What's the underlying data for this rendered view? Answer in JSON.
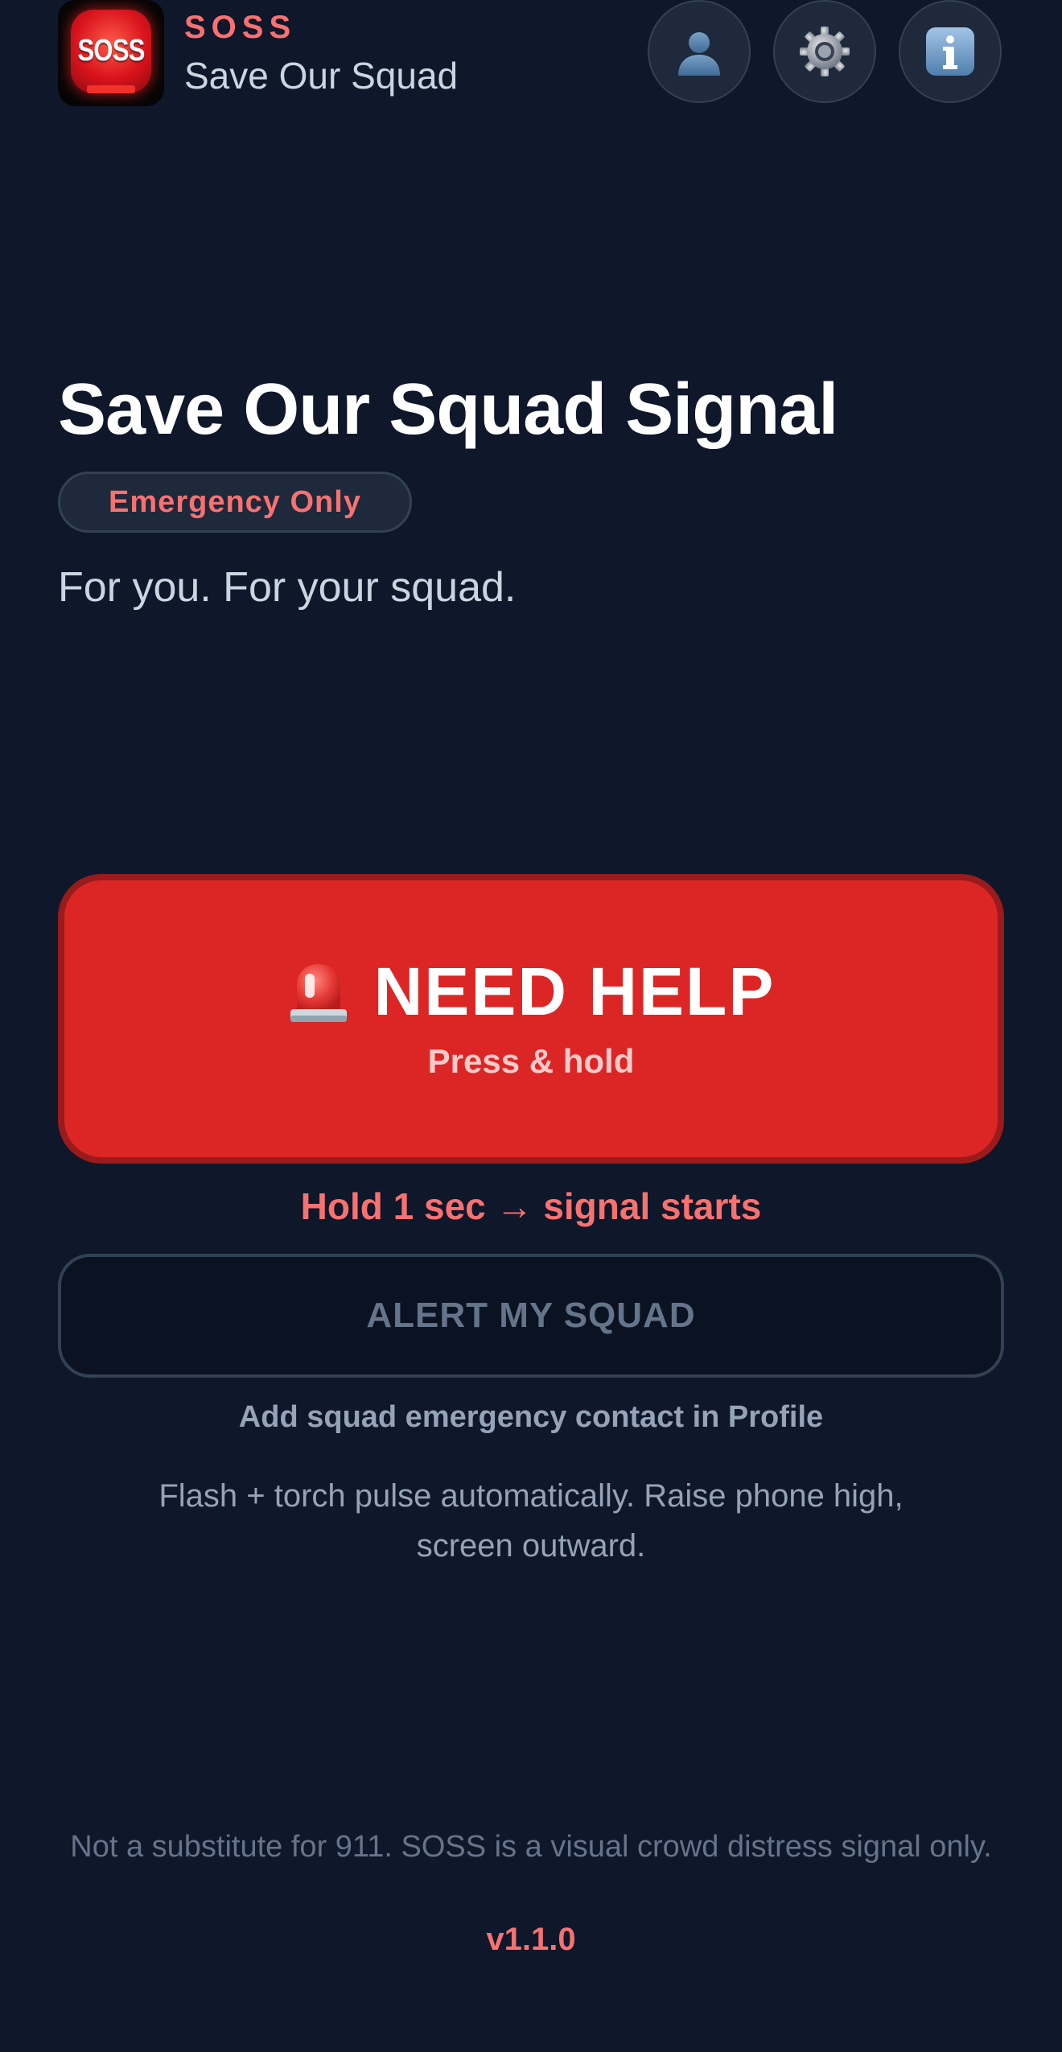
{
  "header": {
    "logo_text": "SOSS",
    "brand_name": "SOSS",
    "tagline": "Save Our Squad",
    "buttons": [
      {
        "name": "profile",
        "icon": "person-icon"
      },
      {
        "name": "settings",
        "icon": "gear-icon"
      },
      {
        "name": "info",
        "icon": "info-icon"
      }
    ]
  },
  "hero": {
    "title": "Save Our Squad Signal",
    "badge": "Emergency Only",
    "subtitle": "For you. For your squad."
  },
  "help_button": {
    "icon": "siren-icon",
    "label": "NEED HELP",
    "sublabel": "Press & hold"
  },
  "hold_hint": "Hold 1 sec → signal starts",
  "alert_button": {
    "label": "ALERT MY SQUAD"
  },
  "squad_hint": "Add squad emergency contact in Profile",
  "flash_hint": "Flash + torch pulse automatically. Raise phone high, screen outward.",
  "footer": {
    "disclaimer": "Not a substitute for 911. SOSS is a visual crowd distress signal only.",
    "version": "v1.1.0"
  },
  "colors": {
    "background": "#0f172a",
    "accent": "#f87171",
    "danger": "#dc2626",
    "danger_border": "#991b1b",
    "muted_text": "#94a3b8"
  }
}
